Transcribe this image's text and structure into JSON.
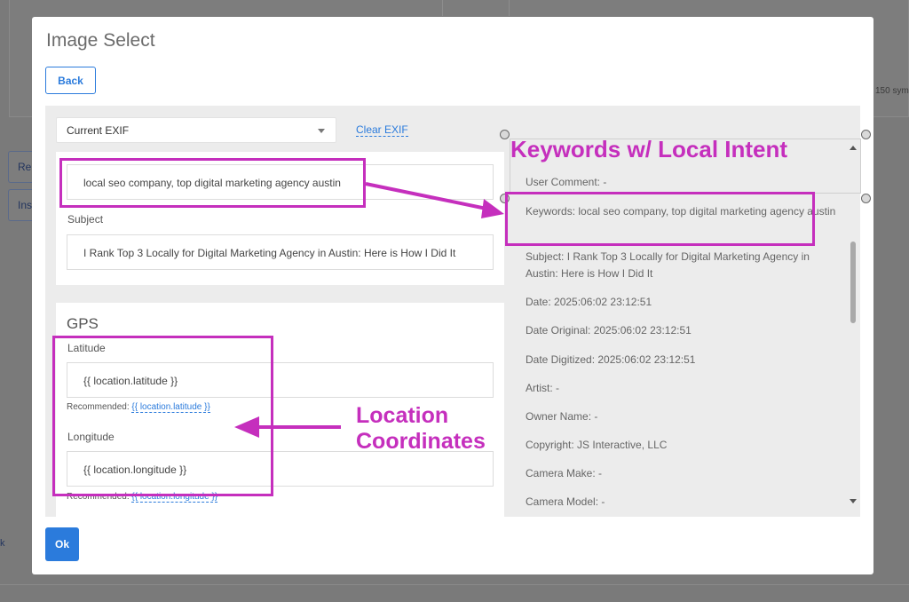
{
  "background": {
    "side_button_1": "Re",
    "side_button_2": "Ins",
    "right_text": "150 sym",
    "left_text": "k"
  },
  "modal": {
    "title": "Image Select",
    "back_label": "Back",
    "ok_label": "Ok"
  },
  "exif_select": {
    "value": "Current EXIF",
    "clear_label": "Clear EXIF"
  },
  "fields": {
    "keywords_value": "local seo company, top digital marketing agency austin",
    "subject_label": "Subject",
    "subject_value": "I Rank Top 3 Locally for Digital Marketing Agency in Austin: Here is How I Did It"
  },
  "gps": {
    "title": "GPS",
    "latitude_label": "Latitude",
    "latitude_value": "{{ location.latitude }}",
    "latitude_rec_prefix": "Recommended:",
    "latitude_rec_link": "{{ location.latitude }}",
    "longitude_label": "Longitude",
    "longitude_value": "{{ location.longitude }}",
    "longitude_rec_prefix": "Recommended:",
    "longitude_rec_link": "{{ location.longitude }}"
  },
  "exif_list": [
    "User Comment: -",
    "Keywords: local seo company, top digital marketing agency austin",
    "Subject: I Rank Top 3 Locally for Digital Marketing Agency in Austin: Here is How I Did It",
    "Date: 2025:06:02 23:12:51",
    "Date Original: 2025:06:02 23:12:51",
    "Date Digitized: 2025:06:02 23:12:51",
    "Artist: -",
    "Owner Name: -",
    "Copyright: JS Interactive, LLC",
    "Camera Make: -",
    "Camera Model: -"
  ],
  "annotations": {
    "keywords_caption": "Keywords w/ Local Intent",
    "location_caption_line1": "Location",
    "location_caption_line2": "Coordinates",
    "color": "#c52fbd"
  },
  "colors": {
    "accent": "#2b7bdc",
    "overlay": "#7a7a7a"
  }
}
